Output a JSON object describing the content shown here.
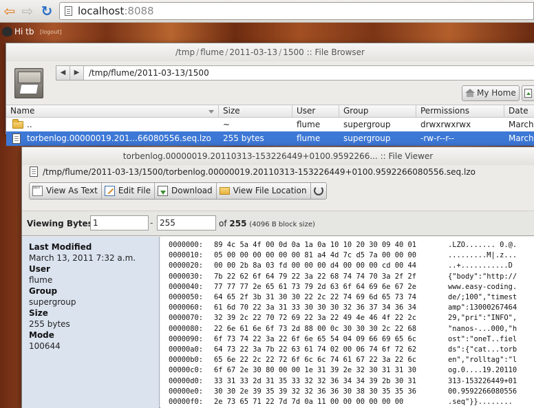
{
  "browser": {
    "url_host": "localhost",
    "url_port": ":8088"
  },
  "hue_bar": {
    "greeting": "Hi tb",
    "logout": "[logout]"
  },
  "file_browser": {
    "title_parts": [
      "/",
      "tmp",
      "/",
      "flume",
      "/",
      "2011-03-13",
      "/",
      "1500",
      " :: File Browser"
    ],
    "path": "/tmp/flume/2011-03-13/1500",
    "home_button": "My Home",
    "upload_button": "U",
    "columns": [
      "Name",
      "Size",
      "User",
      "Group",
      "Permissions",
      "Date"
    ],
    "rows": [
      {
        "name": "..",
        "size": "~",
        "user": "flume",
        "group": "supergroup",
        "permissions": "drwxrwxrwx",
        "date": "March"
      },
      {
        "name": "torbenlog.00000019.201...66080556.seq.lzo",
        "size": "255 bytes",
        "user": "flume",
        "group": "supergroup",
        "permissions": "-rw-r--r--",
        "date": "March"
      }
    ]
  },
  "file_viewer": {
    "title": "torbenlog.00000019.20110313-153226449+0100.9592266... :: File Viewer",
    "path": "/tmp/flume/2011-03-13/1500/torbenlog.00000019.20110313-153226449+0100.9592266080556.seq.lzo",
    "toolbar": {
      "view_as_text": "View As Text",
      "edit_file": "Edit File",
      "download": "Download",
      "view_location": "View File Location"
    },
    "text_icon_glyph": "abcd",
    "viewing": {
      "label": "Viewing Bytes:",
      "start": "1",
      "dash": "-",
      "end": "255",
      "of_prefix": "of",
      "total": "255",
      "block_size": "(4096 B block size)"
    },
    "meta": [
      {
        "label": "Last Modified",
        "value": "March 13, 2011 7:32 a.m."
      },
      {
        "label": "User",
        "value": "flume"
      },
      {
        "label": "Group",
        "value": "supergroup"
      },
      {
        "label": "Size",
        "value": "255 bytes"
      },
      {
        "label": "Mode",
        "value": "100644"
      }
    ],
    "hex_lines": [
      {
        "offset": "0000000:",
        "bytes": "89 4c 5a 4f 00 0d 0a 1a 0a 10 10 20 30 09 40 01",
        "ascii": ".LZO....... 0.@."
      },
      {
        "offset": "0000010:",
        "bytes": "05 00 00 00 00 00 00 81 a4 4d 7c d5 7a 00 00 00",
        "ascii": ".........M|.z..."
      },
      {
        "offset": "0000020:",
        "bytes": "00 00 2b 8a 03 fd 00 00 00 d4 00 00 00 cd 00 44",
        "ascii": "..+...........D"
      },
      {
        "offset": "0000030:",
        "bytes": "7b 22 62 6f 64 79 22 3a 22 68 74 74 70 3a 2f 2f",
        "ascii": "{\"body\":\"http://"
      },
      {
        "offset": "0000040:",
        "bytes": "77 77 77 2e 65 61 73 79 2d 63 6f 64 69 6e 67 2e",
        "ascii": "www.easy-coding."
      },
      {
        "offset": "0000050:",
        "bytes": "64 65 2f 3b 31 30 30 22 2c 22 74 69 6d 65 73 74",
        "ascii": "de/;100\",\"timest"
      },
      {
        "offset": "0000060:",
        "bytes": "61 6d 70 22 3a 31 33 30 30 30 32 36 37 34 36 34",
        "ascii": "amp\":13000267464"
      },
      {
        "offset": "0000070:",
        "bytes": "32 39 2c 22 70 72 69 22 3a 22 49 4e 46 4f 22 2c",
        "ascii": "29,\"pri\":\"INFO\","
      },
      {
        "offset": "0000080:",
        "bytes": "22 6e 61 6e 6f 73 2d 88 00 0c 30 30 30 2c 22 68",
        "ascii": "\"nanos-...000,\"h"
      },
      {
        "offset": "0000090:",
        "bytes": "6f 73 74 22 3a 22 6f 6e 65 54 04 09 66 69 65 6c",
        "ascii": "ost\":\"oneT..fiel"
      },
      {
        "offset": "00000a0:",
        "bytes": "64 73 22 3a 7b 22 63 61 74 02 00 06 74 6f 72 62",
        "ascii": "ds\":{\"cat...torb"
      },
      {
        "offset": "00000b0:",
        "bytes": "65 6e 22 2c 22 72 6f 6c 6c 74 61 67 22 3a 22 6c",
        "ascii": "en\",\"rolltag\":\"l"
      },
      {
        "offset": "00000c0:",
        "bytes": "6f 67 2e 30 80 00 00 1e 31 39 2e 32 30 31 31 30",
        "ascii": "og.0....19.20110"
      },
      {
        "offset": "00000d0:",
        "bytes": "33 31 33 2d 31 35 33 32 32 36 34 34 39 2b 30 31",
        "ascii": "313-153226449+01"
      },
      {
        "offset": "00000e0:",
        "bytes": "30 30 2e 39 35 39 32 32 36 36 30 38 30 35 35 36",
        "ascii": "00.9592266080556"
      },
      {
        "offset": "00000f0:",
        "bytes": "2e 73 65 71 22 7d 7d 0a 11 00 00 00 00 00 00",
        "ascii": ".seq\"}}........"
      }
    ]
  }
}
